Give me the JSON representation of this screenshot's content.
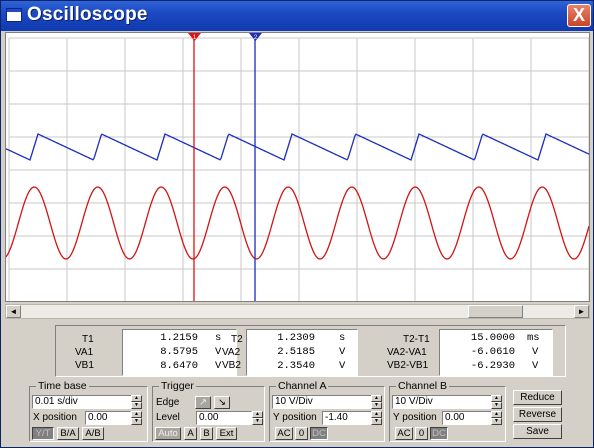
{
  "window": {
    "title": "Oscilloscope",
    "close_symbol": "X"
  },
  "cursors": {
    "t1_label": "1",
    "t2_label": "2",
    "t1_color": "#e21010",
    "t2_color": "#1a2eb8"
  },
  "channels": {
    "a_color": "#d21414",
    "b_color": "#1c2ec0"
  },
  "scrollbar": {
    "left_arrow": "◄",
    "right_arrow": "►"
  },
  "readout": {
    "col1": [
      {
        "label": "T1",
        "value": "1.2159",
        "unit": "s"
      },
      {
        "label": "VA1",
        "value": "8.5795",
        "unit": "V"
      },
      {
        "label": "VB1",
        "value": "8.6470",
        "unit": "V"
      }
    ],
    "col2": [
      {
        "label": "T2",
        "value": "1.2309",
        "unit": "s"
      },
      {
        "label": "VA2",
        "value": "2.5185",
        "unit": "V"
      },
      {
        "label": "VB2",
        "value": "2.3540",
        "unit": "V"
      }
    ],
    "col3": [
      {
        "label": "T2-T1",
        "value": "15.0000",
        "unit": "ms"
      },
      {
        "label": "VA2-VA1",
        "value": "-6.0610",
        "unit": "V"
      },
      {
        "label": "VB2-VB1",
        "value": "-6.2930",
        "unit": "V"
      }
    ]
  },
  "timebase": {
    "title": "Time base",
    "scale": "0.01 s/div",
    "xpos_label": "X position",
    "xpos": "0.00",
    "btn_yt": "Y/T",
    "btn_ba": "B/A",
    "btn_ab": "A/B"
  },
  "trigger": {
    "title": "Trigger",
    "edge_label": "Edge",
    "edge_rise": "↗",
    "edge_fall": "↘",
    "level_label": "Level",
    "level": "0.00",
    "btn_auto": "Auto",
    "btn_a": "A",
    "btn_b": "B",
    "btn_ext": "Ext"
  },
  "channel_a": {
    "title": "Channel A",
    "scale": "10 V/Div",
    "ypos_label": "Y position",
    "ypos": "-1.40",
    "btn_ac": "AC",
    "btn_0": "0",
    "btn_dc": "DC"
  },
  "channel_b": {
    "title": "Channel B",
    "scale": "10 V/Div",
    "ypos_label": "Y position",
    "ypos": "0.00",
    "btn_ac": "AC",
    "btn_0": "0",
    "btn_dc": "DC"
  },
  "actions": {
    "reduce": "Reduce",
    "reverse": "Reverse",
    "save": "Save"
  }
}
